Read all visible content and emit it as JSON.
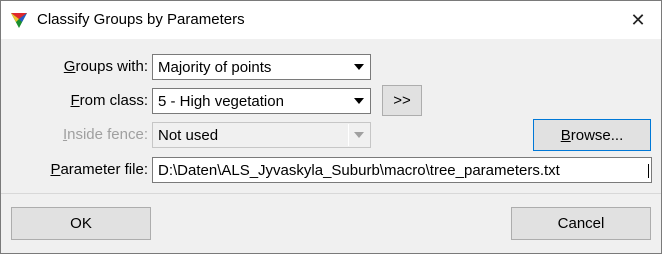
{
  "window": {
    "title": "Classify Groups by Parameters",
    "close_symbol": "✕"
  },
  "form": {
    "groups_with": {
      "label_accel": "G",
      "label_rest": "roups with:",
      "value": "Majority of points"
    },
    "from_class": {
      "label_accel": "F",
      "label_rest": "rom class:",
      "value": "5 - High vegetation",
      "more_button": ">>"
    },
    "inside_fence": {
      "label_accel": "I",
      "label_rest": "nside fence:",
      "value": "Not used",
      "disabled": true
    },
    "parameter_file": {
      "label_accel": "P",
      "label_rest": "arameter file:",
      "value": "D:\\Daten\\ALS_Jyvaskyla_Suburb\\macro\\tree_parameters.txt",
      "browse_accel": "B",
      "browse_rest": "rowse..."
    }
  },
  "footer": {
    "ok_label": "OK",
    "cancel_label": "Cancel"
  },
  "icons": {
    "app": "terrasolid-triangle-icon",
    "close": "close-icon",
    "dropdown": "chevron-down-icon"
  }
}
